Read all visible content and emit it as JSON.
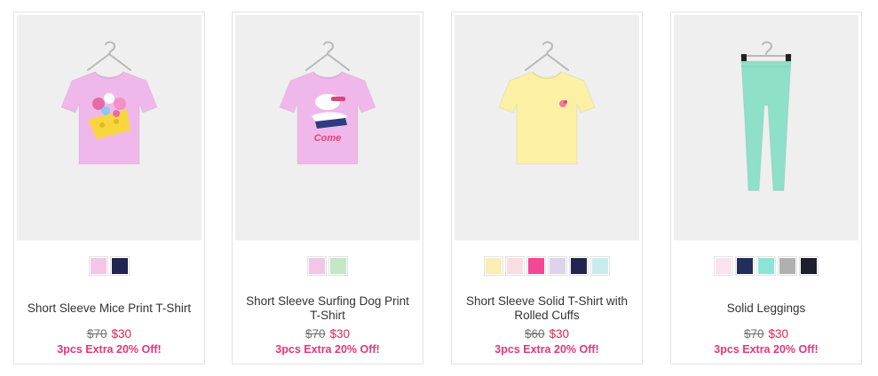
{
  "products": [
    {
      "name": "Short Sleeve Mice Print T-Shirt",
      "old_price": "$70",
      "new_price": "$30",
      "promo": "3pcs Extra 20% Off!",
      "swatches": [
        "#f3c6e8",
        "#1f2550"
      ]
    },
    {
      "name": "Short Sleeve Surfing Dog Print T-Shirt",
      "old_price": "$70",
      "new_price": "$30",
      "promo": "3pcs Extra 20% Off!",
      "swatches": [
        "#f3c6e8",
        "#c3e7c7"
      ]
    },
    {
      "name": "Short Sleeve Solid T-Shirt with Rolled Cuffs",
      "old_price": "$60",
      "new_price": "$30",
      "promo": "3pcs Extra 20% Off!",
      "swatches": [
        "#fbeeb2",
        "#f8dde3",
        "#f44795",
        "#ddd3ec",
        "#24254f",
        "#c8ecec"
      ]
    },
    {
      "name": "Solid Leggings",
      "old_price": "$70",
      "new_price": "$30",
      "promo": "3pcs Extra 20% Off!",
      "swatches": [
        "#fae3ef",
        "#222d5c",
        "#8be4d6",
        "#b0b0b0",
        "#1e1f2e"
      ]
    }
  ],
  "garments": [
    {
      "kind": "tshirt",
      "color": "#f0b8ea",
      "print": "mice"
    },
    {
      "kind": "tshirt",
      "color": "#f0b8ea",
      "print": "dog"
    },
    {
      "kind": "tshirt",
      "color": "#fbf0a4",
      "print": "small-logo"
    },
    {
      "kind": "leggings",
      "color": "#8fe0c8",
      "print": "none"
    }
  ]
}
